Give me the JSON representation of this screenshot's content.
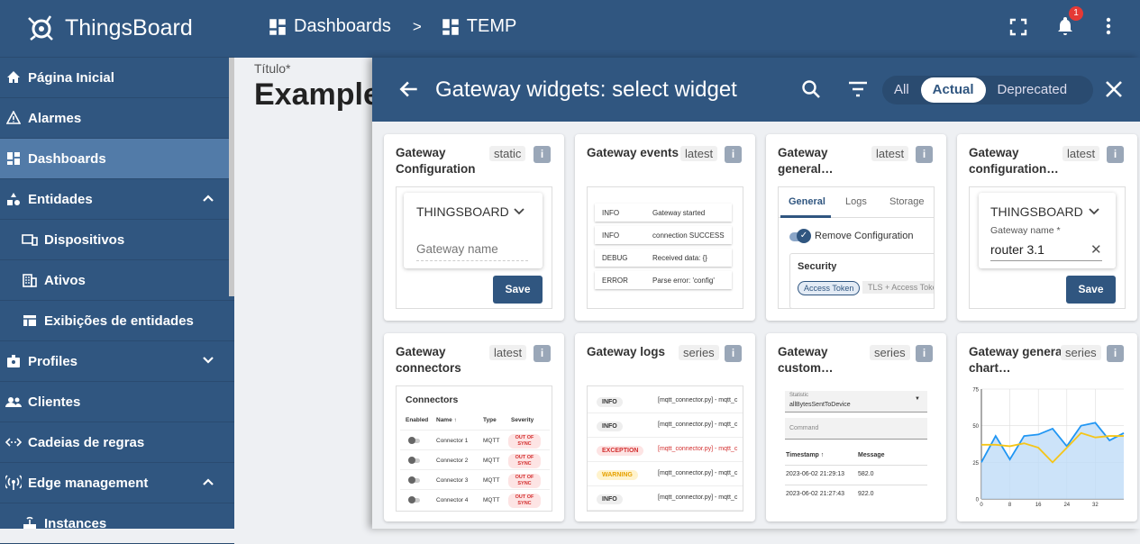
{
  "app": {
    "brand": "ThingsBoard"
  },
  "sidebar": {
    "items": [
      {
        "label": "Página Inicial",
        "icon": "home-icon"
      },
      {
        "label": "Alarmes",
        "icon": "alarm-icon"
      },
      {
        "label": "Dashboards",
        "icon": "dashboards-icon"
      },
      {
        "label": "Entidades",
        "icon": "entities-icon"
      },
      {
        "label": "Dispositivos",
        "icon": "devices-icon"
      },
      {
        "label": "Ativos",
        "icon": "assets-icon"
      },
      {
        "label": "Exibições de entidades",
        "icon": "entity-views-icon"
      },
      {
        "label": "Profiles",
        "icon": "profiles-icon"
      },
      {
        "label": "Clientes",
        "icon": "customers-icon"
      },
      {
        "label": "Cadeias de regras",
        "icon": "rule-chains-icon"
      },
      {
        "label": "Edge management",
        "icon": "edge-icon"
      },
      {
        "label": "Instances",
        "icon": "instances-icon"
      }
    ]
  },
  "topbar": {
    "crumb1": "Dashboards",
    "sep": ">",
    "crumb2": "TEMP",
    "notifications": "1"
  },
  "background": {
    "title_label": "Título*",
    "title": "Example"
  },
  "panel": {
    "title": "Gateway widgets: select widget",
    "filters": [
      "All",
      "Actual",
      "Deprecated"
    ]
  },
  "cards": [
    {
      "title": "Gateway Configuration",
      "badge": "static"
    },
    {
      "title": "Gateway events",
      "badge": "latest"
    },
    {
      "title": "Gateway general…",
      "badge": "latest"
    },
    {
      "title": "Gateway configuration…",
      "badge": "latest"
    },
    {
      "title": "Gateway connectors",
      "badge": "latest"
    },
    {
      "title": "Gateway logs",
      "badge": "series"
    },
    {
      "title": "Gateway custom…",
      "badge": "series"
    },
    {
      "title": "Gateway general chart…",
      "badge": "series"
    }
  ],
  "info_label": "i",
  "previews": {
    "c1": {
      "select": "THINGSBOARD",
      "field": "Gateway name",
      "save": "Save"
    },
    "c2": {
      "rows": [
        [
          "INFO",
          "Gateway started"
        ],
        [
          "INFO",
          "connection SUCCESS"
        ],
        [
          "DEBUG",
          "Received data: {}"
        ],
        [
          "ERROR",
          "Parse error: 'config'"
        ]
      ]
    },
    "c3": {
      "tabs": [
        "General",
        "Logs",
        "Storage"
      ],
      "toggle": "Remove Configuration",
      "security": "Security",
      "chip1": "Access Token",
      "chip2": "TLS + Access Toke"
    },
    "c4": {
      "select": "THINGSBOARD",
      "field_label": "Gateway name *",
      "field_value": "router 3.1",
      "save": "Save"
    },
    "c5": {
      "title": "Connectors",
      "headers": [
        "Enabled",
        "Name ↑",
        "Type",
        "Severity"
      ],
      "rows": [
        [
          "Connector 1",
          "MQTT",
          "OUT OF SYNC"
        ],
        [
          "Connector 2",
          "MQTT",
          "OUT OF SYNC"
        ],
        [
          "Connector 3",
          "MQTT",
          "OUT OF SYNC"
        ],
        [
          "Connector 4",
          "MQTT",
          "OUT OF SYNC"
        ]
      ]
    },
    "c6": {
      "rows": [
        [
          "INFO",
          "[mqtt_connector.py] - mqtt_c"
        ],
        [
          "INFO",
          "[mqtt_connector.py] - mqtt_c"
        ],
        [
          "EXCEPTION",
          "[mqtt_connector.py] - mqtt_c"
        ],
        [
          "WARNING",
          "[mqtt_connector.py] - mqtt_c"
        ],
        [
          "INFO",
          "[mqtt_connector.py] - mqtt_c"
        ]
      ]
    },
    "c7": {
      "stat_label": "Statistic",
      "stat_value": "allBytesSentToDevice",
      "command": "Command",
      "col1": "Timestamp ↑",
      "col2": "Message",
      "rows": [
        [
          "2023-06-02 21:29:13",
          "582.0"
        ],
        [
          "2023-06-02 21:27:43",
          "922.0"
        ]
      ]
    }
  },
  "colors": {
    "primary": "#305680",
    "accent": "#527ba8"
  },
  "chart_data": {
    "type": "line",
    "x": [
      0,
      4,
      8,
      12,
      16,
      20,
      24,
      28,
      32,
      36,
      40
    ],
    "series": [
      {
        "values": [
          25,
          43,
          27,
          43,
          44,
          48,
          36,
          50,
          52,
          40,
          45
        ],
        "color": "#2196f3"
      },
      {
        "values": [
          37,
          37,
          36,
          38,
          35,
          25,
          35,
          45,
          42,
          43,
          43
        ],
        "color": "#f5c518"
      }
    ],
    "ylim": [
      0,
      75
    ],
    "yticks": [
      "75",
      "50",
      "25",
      "0"
    ],
    "xticks": [
      "0",
      "8",
      "16",
      "24",
      "32"
    ]
  }
}
